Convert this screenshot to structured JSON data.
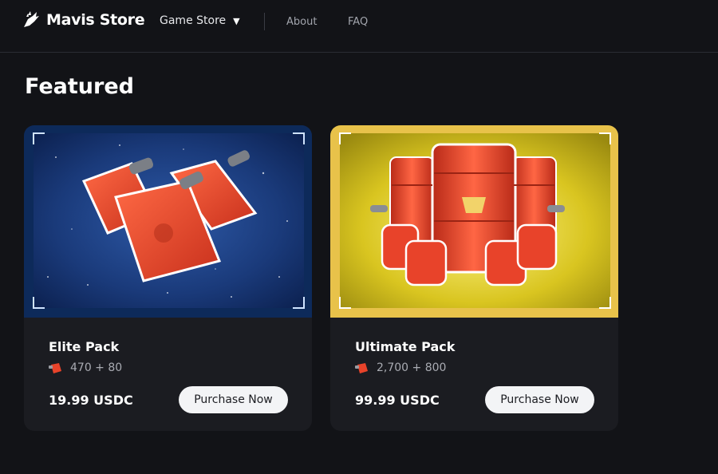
{
  "header": {
    "brand": "Mavis Store",
    "nav": {
      "game_store": "Game Store",
      "about": "About",
      "faq": "FAQ"
    }
  },
  "main": {
    "section_title": "Featured",
    "cards": [
      {
        "title": "Elite Pack",
        "amount": "470 + 80",
        "price": "19.99 USDC",
        "button": "Purchase Now"
      },
      {
        "title": "Ultimate Pack",
        "amount": "2,700 + 800",
        "price": "99.99 USDC",
        "button": "Purchase Now"
      }
    ]
  },
  "colors": {
    "background": "#121317",
    "card": "#1b1c21",
    "fuel_red": "#e8432a",
    "elite_border": "#0d2a5a",
    "ultimate_border": "#e8c24a"
  },
  "icons": {
    "brand": "bird-logo-icon",
    "caret": "caret-down-icon",
    "fuel": "fuel-can-icon"
  }
}
